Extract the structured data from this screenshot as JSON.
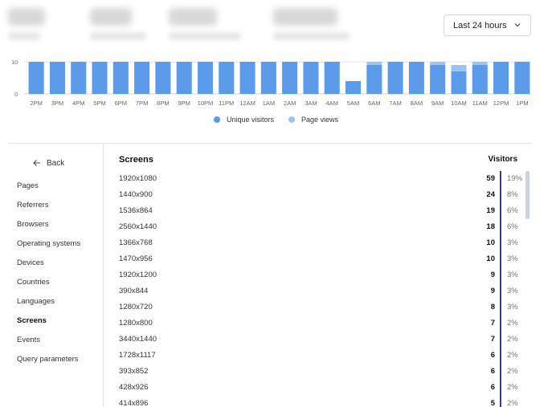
{
  "header": {
    "range_label": "Last 24 hours"
  },
  "chart_data": {
    "type": "bar",
    "categories": [
      "2PM",
      "3PM",
      "4PM",
      "5PM",
      "6PM",
      "7PM",
      "8PM",
      "9PM",
      "10PM",
      "11PM",
      "12AM",
      "1AM",
      "2AM",
      "3AM",
      "4AM",
      "5AM",
      "6AM",
      "7AM",
      "8AM",
      "9AM",
      "10AM",
      "11AM",
      "12PM",
      "1PM"
    ],
    "series": [
      {
        "name": "Unique visitors",
        "values": [
          10,
          10,
          10,
          10,
          10,
          10,
          10,
          10,
          10,
          10,
          10,
          10,
          10,
          10,
          10,
          4,
          9,
          10,
          10,
          9,
          7,
          9,
          10,
          10
        ]
      },
      {
        "name": "Page views",
        "values": [
          10,
          10,
          10,
          10,
          10,
          10,
          10,
          10,
          10,
          10,
          10,
          10,
          10,
          10,
          10,
          4,
          10,
          10,
          10,
          10,
          9,
          10,
          10,
          10
        ]
      }
    ],
    "y_ticks": [
      "10",
      "0"
    ],
    "ylim": [
      0,
      10
    ],
    "colors": {
      "unique": "#5b9bea",
      "views": "#9ac4f2"
    },
    "legend": "bottom-center"
  },
  "sidebar": {
    "back_label": "Back",
    "items": [
      "Pages",
      "Referrers",
      "Browsers",
      "Operating systems",
      "Devices",
      "Countries",
      "Languages",
      "Screens",
      "Events",
      "Query parameters"
    ],
    "active": "Screens"
  },
  "table": {
    "title": "Screens",
    "metric": "Visitors",
    "rows": [
      {
        "name": "1920x1080",
        "count": "59",
        "pct": "19%"
      },
      {
        "name": "1440x900",
        "count": "24",
        "pct": "8%"
      },
      {
        "name": "1536x864",
        "count": "19",
        "pct": "6%"
      },
      {
        "name": "2560x1440",
        "count": "18",
        "pct": "6%"
      },
      {
        "name": "1366x768",
        "count": "10",
        "pct": "3%"
      },
      {
        "name": "1470x956",
        "count": "10",
        "pct": "3%"
      },
      {
        "name": "1920x1200",
        "count": "9",
        "pct": "3%"
      },
      {
        "name": "390x844",
        "count": "9",
        "pct": "3%"
      },
      {
        "name": "1280x720",
        "count": "8",
        "pct": "3%"
      },
      {
        "name": "1280x800",
        "count": "7",
        "pct": "2%"
      },
      {
        "name": "3440x1440",
        "count": "7",
        "pct": "2%"
      },
      {
        "name": "1728x1117",
        "count": "6",
        "pct": "2%"
      },
      {
        "name": "393x852",
        "count": "6",
        "pct": "2%"
      },
      {
        "name": "428x926",
        "count": "6",
        "pct": "2%"
      },
      {
        "name": "414x896",
        "count": "5",
        "pct": "2%"
      }
    ]
  }
}
